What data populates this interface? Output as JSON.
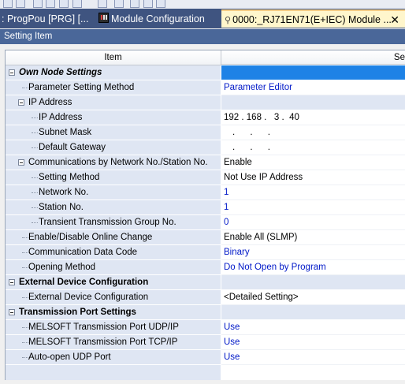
{
  "tabs": [
    {
      "label": ": ProgPou [PRG] [..."
    },
    {
      "label": "Module Configuration"
    },
    {
      "label": "0000:_RJ71EN71(E+IEC) Module ..."
    }
  ],
  "panel": {
    "title": "Setting Item"
  },
  "columns": {
    "item": "Item",
    "setting": "Se"
  },
  "rows": [
    {
      "label": "Own Node Settings",
      "value": ""
    },
    {
      "label": "Parameter Setting Method",
      "value": "Parameter Editor"
    },
    {
      "label": "IP Address",
      "value": ""
    },
    {
      "label": "IP Address",
      "value": "192 . 168 .   3 .  40"
    },
    {
      "label": "Subnet Mask",
      "value": ".      .      ."
    },
    {
      "label": "Default Gateway",
      "value": ".      .      ."
    },
    {
      "label": "Communications by Network No./Station No.",
      "value": "Enable"
    },
    {
      "label": "Setting Method",
      "value": "Not Use IP Address"
    },
    {
      "label": "Network No.",
      "value": "1"
    },
    {
      "label": "Station No.",
      "value": "1"
    },
    {
      "label": "Transient Transmission Group No.",
      "value": "0"
    },
    {
      "label": "Enable/Disable Online Change",
      "value": "Enable All (SLMP)"
    },
    {
      "label": "Communication Data Code",
      "value": "Binary"
    },
    {
      "label": "Opening Method",
      "value": "Do Not Open by Program"
    },
    {
      "label": "External Device Configuration",
      "value": ""
    },
    {
      "label": "External Device Configuration",
      "value": "<Detailed Setting>"
    },
    {
      "label": "Transmission Port Settings",
      "value": ""
    },
    {
      "label": "MELSOFT Transmission Port UDP/IP",
      "value": "Use"
    },
    {
      "label": "MELSOFT Transmission Port TCP/IP",
      "value": "Use"
    },
    {
      "label": "Auto-open UDP Port",
      "value": "Use"
    }
  ],
  "colors": {
    "accent": "#1e82e6",
    "tabbar": "#3f5480",
    "panel_header": "#4a6799",
    "value_blue": "#0018c8"
  }
}
